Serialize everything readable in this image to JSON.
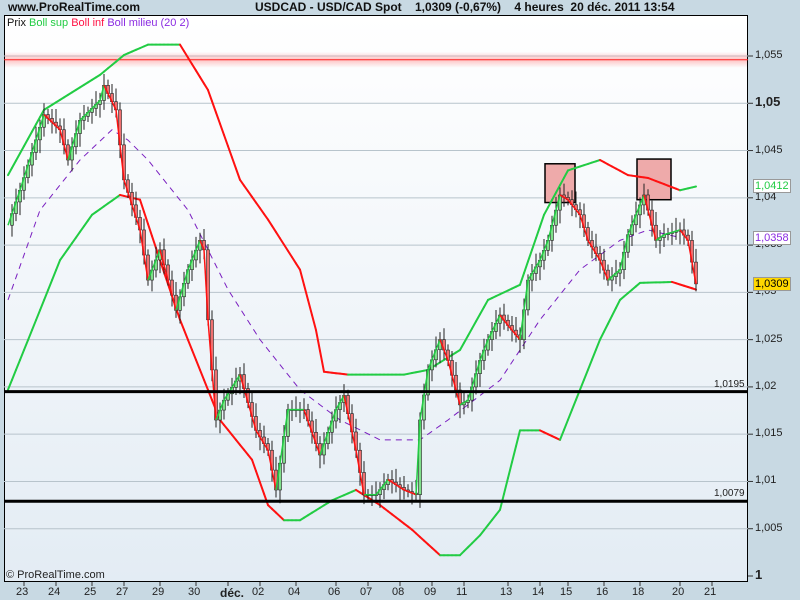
{
  "header": {
    "site": "www.ProRealTime.com",
    "title": "USDCAD - USD/CAD Spot    1,0309 (-0,67%)    4 heures  20 déc. 2011 13:54"
  },
  "legend": {
    "price": "Prix",
    "upper": "Boll sup",
    "lower": "Boll inf",
    "middle": "Boll milieu",
    "params": "(20 2)"
  },
  "footer": {
    "copyright": "© ProRealTime.com"
  },
  "colors": {
    "up": "#22cc44",
    "down": "#ff1111",
    "middle": "#7a1fc0",
    "last": "#ffd800"
  },
  "chart_data": {
    "type": "candlestick",
    "title": "USDCAD - USD/CAD Spot",
    "ylim": [
      1.0,
      1.057
    ],
    "y_ticks": [
      "1,055",
      "1,05",
      "1,045",
      "1,04",
      "1,035",
      "1,03",
      "1,025",
      "1,02",
      "1,015",
      "1,01",
      "1,005",
      "1"
    ],
    "y_tick_values": [
      1.055,
      1.05,
      1.045,
      1.04,
      1.035,
      1.03,
      1.025,
      1.02,
      1.015,
      1.01,
      1.005,
      1.0
    ],
    "x_ticks": [
      {
        "label": "23",
        "bar": 4
      },
      {
        "label": "24",
        "bar": 12
      },
      {
        "label": "25",
        "bar": 21
      },
      {
        "label": "27",
        "bar": 29
      },
      {
        "label": "29",
        "bar": 38
      },
      {
        "label": "30",
        "bar": 47
      },
      {
        "label": "déc.",
        "bar": 55
      },
      {
        "label": "02",
        "bar": 63
      },
      {
        "label": "04",
        "bar": 72
      },
      {
        "label": "06",
        "bar": 82
      },
      {
        "label": "07",
        "bar": 90
      },
      {
        "label": "08",
        "bar": 98
      },
      {
        "label": "09",
        "bar": 106
      },
      {
        "label": "11",
        "bar": 114
      },
      {
        "label": "13",
        "bar": 125
      },
      {
        "label": "14",
        "bar": 133
      },
      {
        "label": "15",
        "bar": 140
      },
      {
        "label": "16",
        "bar": 149
      },
      {
        "label": "18",
        "bar": 158
      },
      {
        "label": "20",
        "bar": 168
      },
      {
        "label": "21",
        "bar": 176
      }
    ],
    "price": [
      [
        0,
        1.0371
      ],
      [
        3,
        1.0408
      ],
      [
        9,
        1.0488
      ],
      [
        13,
        1.0472
      ],
      [
        15,
        1.044
      ],
      [
        18,
        1.0482
      ],
      [
        23,
        1.0503
      ],
      [
        24,
        1.0519
      ],
      [
        27,
        1.0493
      ],
      [
        29,
        1.0419
      ],
      [
        33,
        1.0366
      ],
      [
        35,
        1.0313
      ],
      [
        38,
        1.0345
      ],
      [
        42,
        1.0281
      ],
      [
        45,
        1.0324
      ],
      [
        48,
        1.0355
      ],
      [
        49,
        1.0345
      ],
      [
        50,
        1.0271
      ],
      [
        52,
        1.0165
      ],
      [
        54,
        1.0186
      ],
      [
        58,
        1.0213
      ],
      [
        62,
        1.0154
      ],
      [
        65,
        1.0133
      ],
      [
        67,
        1.0091
      ],
      [
        70,
        1.0176
      ],
      [
        74,
        1.0176
      ],
      [
        78,
        1.0128
      ],
      [
        82,
        1.0176
      ],
      [
        84,
        1.0191
      ],
      [
        87,
        1.0133
      ],
      [
        89,
        1.0086
      ],
      [
        92,
        1.0086
      ],
      [
        95,
        1.0102
      ],
      [
        99,
        1.0091
      ],
      [
        102,
        1.0086
      ],
      [
        103,
        1.0165
      ],
      [
        105,
        1.0218
      ],
      [
        108,
        1.025
      ],
      [
        110,
        1.0228
      ],
      [
        113,
        1.0181
      ],
      [
        115,
        1.0186
      ],
      [
        118,
        1.0228
      ],
      [
        120,
        1.025
      ],
      [
        123,
        1.0276
      ],
      [
        125,
        1.0265
      ],
      [
        128,
        1.025
      ],
      [
        130,
        1.0313
      ],
      [
        133,
        1.0334
      ],
      [
        135,
        1.0355
      ],
      [
        138,
        1.0403
      ],
      [
        140,
        1.0398
      ],
      [
        143,
        1.0382
      ],
      [
        145,
        1.0355
      ],
      [
        148,
        1.0334
      ],
      [
        150,
        1.0313
      ],
      [
        153,
        1.0324
      ],
      [
        155,
        1.0361
      ],
      [
        159,
        1.0403
      ],
      [
        162,
        1.0355
      ],
      [
        164,
        1.0361
      ],
      [
        168,
        1.0366
      ],
      [
        170,
        1.0355
      ],
      [
        172,
        1.0309
      ]
    ],
    "boll_sup": [
      [
        0,
        1.0424
      ],
      [
        9,
        1.0493
      ],
      [
        23,
        1.053
      ],
      [
        29,
        1.0551
      ],
      [
        35,
        1.0562
      ],
      [
        43,
        1.0562
      ],
      [
        50,
        1.0514
      ],
      [
        58,
        1.0419
      ],
      [
        65,
        1.0377
      ],
      [
        73,
        1.0324
      ],
      [
        77,
        1.026
      ],
      [
        79,
        1.0216
      ],
      [
        85,
        1.0213
      ],
      [
        93,
        1.0213
      ],
      [
        99,
        1.0213
      ],
      [
        105,
        1.0218
      ],
      [
        113,
        1.0239
      ],
      [
        120,
        1.0292
      ],
      [
        128,
        1.0308
      ],
      [
        134,
        1.0382
      ],
      [
        140,
        1.0429
      ],
      [
        148,
        1.044
      ],
      [
        155,
        1.0424
      ],
      [
        160,
        1.0421
      ],
      [
        168,
        1.0408
      ],
      [
        172,
        1.0412
      ]
    ],
    "boll_inf": [
      [
        0,
        1.0197
      ],
      [
        6,
        1.026
      ],
      [
        13,
        1.0334
      ],
      [
        21,
        1.0382
      ],
      [
        28,
        1.0403
      ],
      [
        33,
        1.0398
      ],
      [
        38,
        1.0334
      ],
      [
        43,
        1.0271
      ],
      [
        48,
        1.0218
      ],
      [
        53,
        1.0165
      ],
      [
        61,
        1.0123
      ],
      [
        65,
        1.0075
      ],
      [
        69,
        1.0059
      ],
      [
        73,
        1.0059
      ],
      [
        81,
        1.008
      ],
      [
        87,
        1.0091
      ],
      [
        93,
        1.0075
      ],
      [
        101,
        1.0049
      ],
      [
        108,
        1.0022
      ],
      [
        113,
        1.0022
      ],
      [
        118,
        1.0043
      ],
      [
        123,
        1.007
      ],
      [
        128,
        1.0154
      ],
      [
        133,
        1.0154
      ],
      [
        138,
        1.0144
      ],
      [
        143,
        1.0197
      ],
      [
        148,
        1.025
      ],
      [
        153,
        1.0292
      ],
      [
        158,
        1.031
      ],
      [
        166,
        1.0311
      ],
      [
        172,
        1.0303
      ]
    ],
    "boll_milieu": [
      [
        0,
        1.0292
      ],
      [
        8,
        1.0387
      ],
      [
        18,
        1.044
      ],
      [
        26,
        1.0472
      ],
      [
        30,
        1.0461
      ],
      [
        35,
        1.044
      ],
      [
        45,
        1.0387
      ],
      [
        55,
        1.0303
      ],
      [
        63,
        1.025
      ],
      [
        73,
        1.0197
      ],
      [
        83,
        1.0165
      ],
      [
        93,
        1.0144
      ],
      [
        103,
        1.0144
      ],
      [
        110,
        1.0165
      ],
      [
        123,
        1.0207
      ],
      [
        133,
        1.0271
      ],
      [
        143,
        1.0324
      ],
      [
        153,
        1.0355
      ],
      [
        160,
        1.0366
      ],
      [
        168,
        1.0358
      ]
    ],
    "hlines": [
      {
        "value": 1.0195,
        "label": "1,0195"
      },
      {
        "value": 1.0079,
        "label": "1,0079"
      }
    ],
    "resistance_line": 1.0546,
    "highlight_boxes": [
      {
        "bar_from": 135,
        "bar_to": 141,
        "low": 1.0395,
        "high": 1.0436
      },
      {
        "bar_from": 158,
        "bar_to": 165,
        "low": 1.0398,
        "high": 1.0441
      }
    ],
    "last_values": {
      "boll_sup": "1,0412",
      "boll_milieu": "1,0358",
      "price": "1,0309"
    }
  }
}
